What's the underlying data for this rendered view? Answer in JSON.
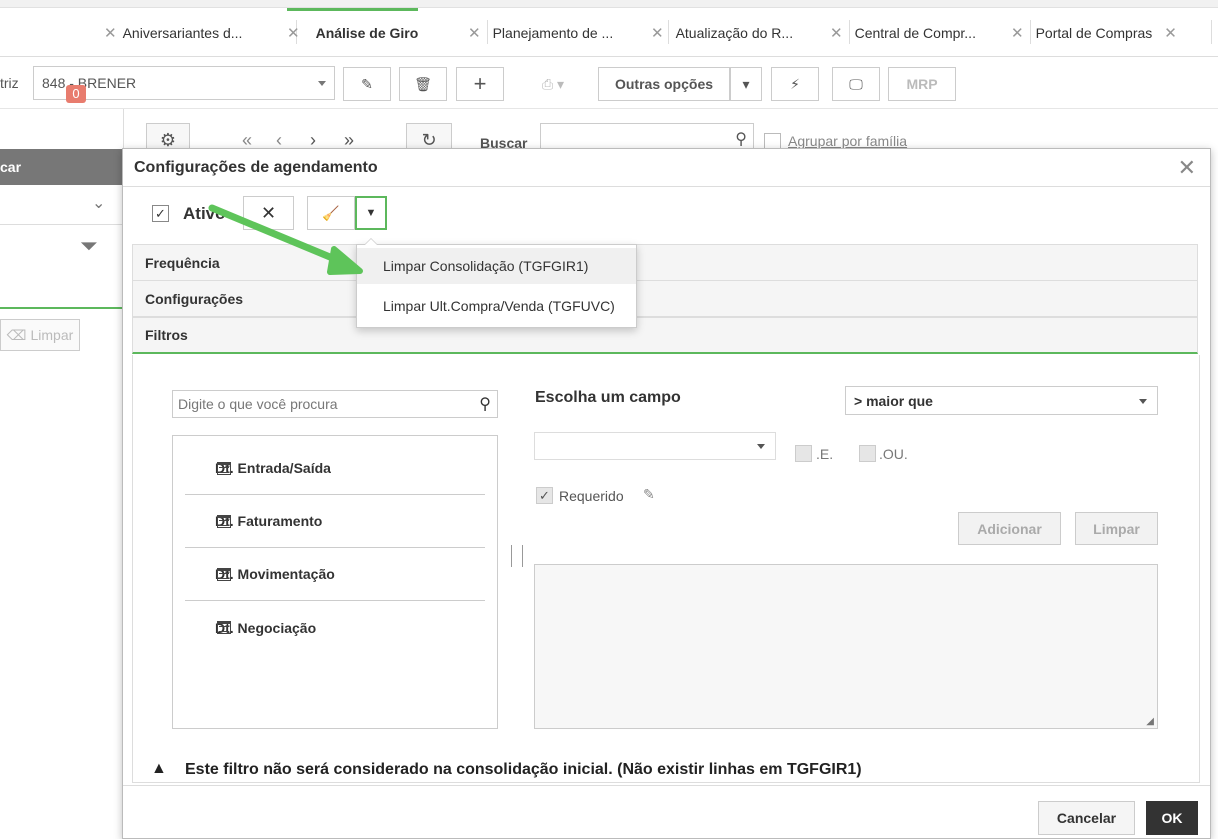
{
  "tabs": [
    {
      "label": "Aniversariantes d..."
    },
    {
      "label": "Análise de Giro"
    },
    {
      "label": "Planejamento de ..."
    },
    {
      "label": "Atualização do R..."
    },
    {
      "label": "Central de Compr..."
    },
    {
      "label": "Portal de Compras"
    }
  ],
  "toolbar": {
    "label_partial": "triz",
    "company_select": "848 - BRENER",
    "more_options": "Outras opções",
    "mrp": "MRP"
  },
  "sidebar": {
    "header_partial": "car",
    "badge": "0",
    "clear_label": "Limpar"
  },
  "grid_toolbar": {
    "search_label": "Buscar",
    "group_label": "Agrupar por família"
  },
  "modal": {
    "title": "Configurações de agendamento",
    "active_label": "Ativo",
    "sections": {
      "frequencia": "Frequência",
      "configuracoes": "Configurações",
      "filtros": "Filtros"
    },
    "dropdown_items": [
      {
        "label": "Limpar Consolidação (TGFGIR1)"
      },
      {
        "label": "Limpar Ult.Compra/Venda (TGFUVC)"
      }
    ],
    "search_placeholder": "Digite o que você procura",
    "fields": [
      {
        "label": "Dt. Entrada/Saída"
      },
      {
        "label": "Dt. Faturamento"
      },
      {
        "label": "Dt. Movimentação"
      },
      {
        "label": "Dt. Negociação"
      }
    ],
    "choose_field_label": "Escolha um campo",
    "operator_select": "> maior que",
    "value_select": "",
    "and_label": ".E.",
    "or_label": ".OU.",
    "required_label": "Requerido",
    "add_button": "Adicionar",
    "clear_button": "Limpar",
    "warning_text": "Este filtro não será considerado na consolidação inicial. (Não existir linhas em TGFGIR1)",
    "cancel_button": "Cancelar",
    "ok_button": "OK"
  },
  "colors": {
    "accent_green": "#5cb85c",
    "arrow_green": "#5ec45a",
    "badge_red": "#e87c6e",
    "sidebar_header": "#777777"
  }
}
